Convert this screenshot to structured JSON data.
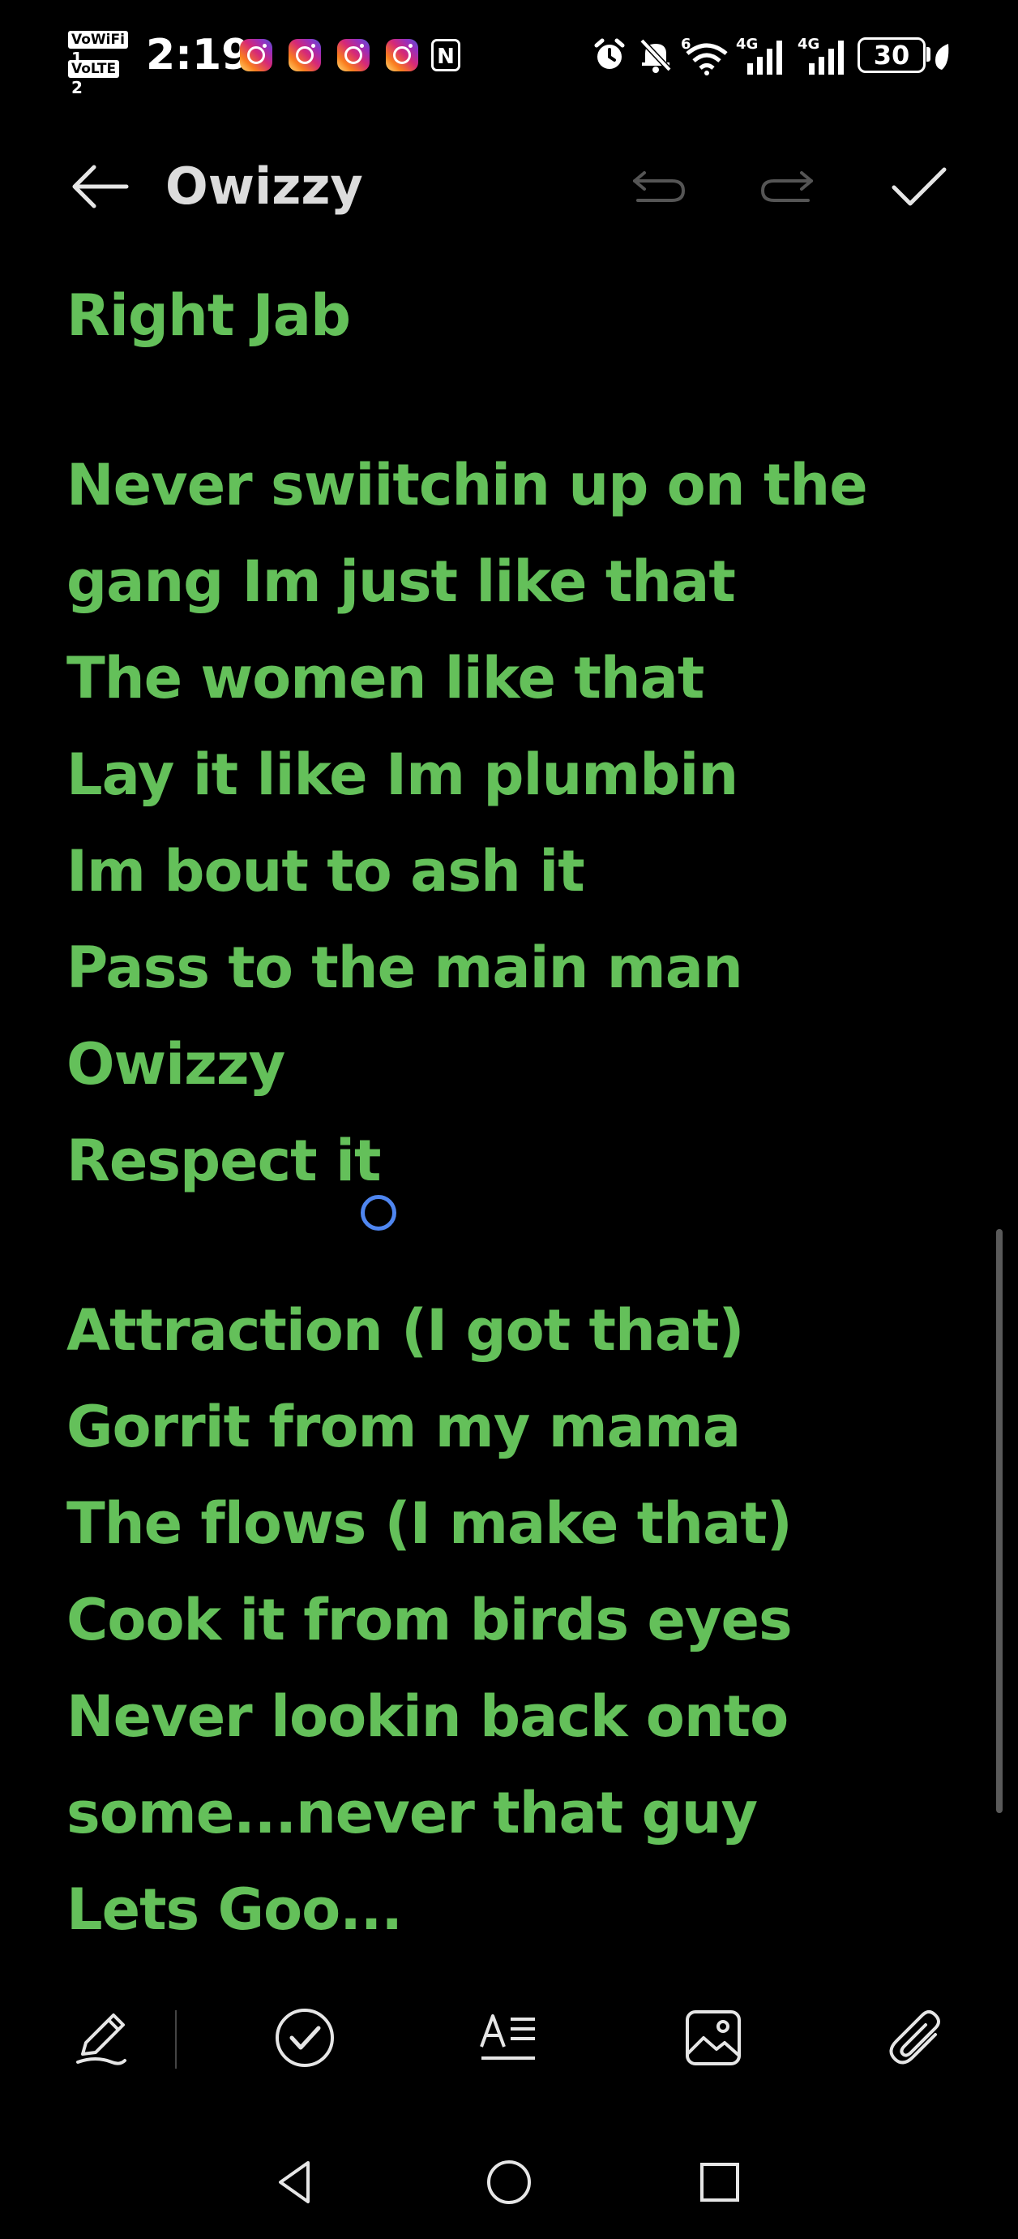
{
  "status_bar": {
    "time": "2:19",
    "sim1_tag": "VoWiFi",
    "sim1_num": "1",
    "sim2_tag": "VoLTE",
    "sim2_num": "2",
    "notification_icons": [
      "instagram-icon",
      "instagram-icon",
      "instagram-icon",
      "instagram-icon",
      "nfc-icon"
    ],
    "nfc_label": "N",
    "right_icons": [
      "alarm-icon",
      "mute-bell-icon",
      "wifi-icon",
      "signal-4g-icon",
      "signal-4g-icon",
      "battery-icon"
    ],
    "wifi_label": "6",
    "signal1_label": "4G",
    "signal2_label": "4G",
    "battery_level": "30"
  },
  "header": {
    "title": "Owizzy",
    "back_icon": "arrow-left-icon",
    "undo_icon": "undo-icon",
    "redo_icon": "redo-icon",
    "done_icon": "checkmark-icon"
  },
  "note": {
    "paragraphs": [
      [
        "Right Jab"
      ],
      [
        "Never swiitchin up on the",
        "gang Im just like that",
        "The women like that",
        "Lay it like Im plumbin",
        "Im bout to ash it",
        "Pass to the main man",
        "Owizzy",
        "Respect it"
      ],
      [
        "Attraction (I got that)",
        "Gorrit from my mama",
        "The flows (I make that)",
        "Cook it from birds eyes",
        "Never lookin back onto",
        "some...never that guy",
        "Lets Goo..."
      ]
    ],
    "text_color": "#64c05a"
  },
  "toolbar": {
    "items": [
      "pen-icon",
      "checklist-icon",
      "text-format-icon",
      "image-icon",
      "attachment-icon"
    ]
  },
  "nav_bar": {
    "items": [
      "back-triangle-icon",
      "home-circle-icon",
      "recents-square-icon"
    ]
  },
  "colors": {
    "background": "#000000",
    "accent_green": "#64c05a",
    "cursor_blue": "#4f86f0"
  }
}
